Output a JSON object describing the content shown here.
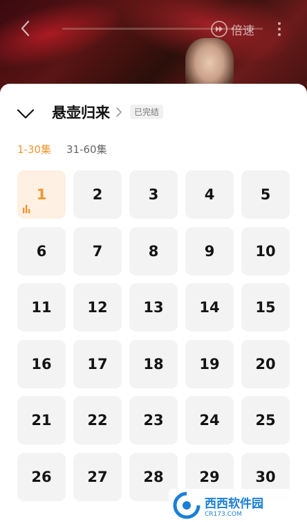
{
  "player": {
    "speed_label": "倍速",
    "back_icon": "chevron-left-icon",
    "speed_icon": "fast-forward-circle-icon",
    "more_icon": "more-vertical-icon"
  },
  "sheet": {
    "title": "悬壶归来",
    "status_badge": "已完结",
    "tabs": [
      {
        "label": "1-30集",
        "active": true
      },
      {
        "label": "31-60集",
        "active": false
      }
    ],
    "active_episode": "1",
    "accent_color": "#f0962e",
    "episodes": [
      "1",
      "2",
      "3",
      "4",
      "5",
      "6",
      "7",
      "8",
      "9",
      "10",
      "11",
      "12",
      "13",
      "14",
      "15",
      "16",
      "17",
      "18",
      "19",
      "20",
      "21",
      "22",
      "23",
      "24",
      "25",
      "26",
      "27",
      "28",
      "29",
      "30"
    ]
  },
  "watermark": {
    "title": "西西软件园",
    "subtitle": "CR173.COM"
  }
}
